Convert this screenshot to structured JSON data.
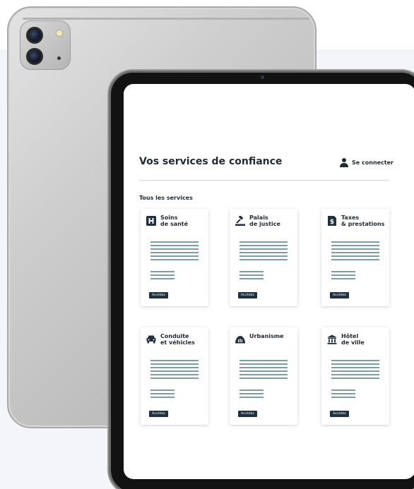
{
  "page": {
    "title": "Vos services de confiance",
    "login_label": "Se connecter",
    "section_label": "Tous les services"
  },
  "colors": {
    "accent_dark": "#1f3140",
    "text_dark": "#1f2a33",
    "placeholder_line": "#7a9ea3",
    "divider": "#cfd4d8"
  },
  "services": [
    {
      "title": "Soins\nde santé",
      "icon": "hospital-icon",
      "button_label": "Accédez"
    },
    {
      "title": "Palais\nde justice",
      "icon": "gavel-icon",
      "button_label": "Accédez"
    },
    {
      "title": "Taxes\n& prestations",
      "icon": "tax-document-icon",
      "button_label": "Accédez"
    },
    {
      "title": "Conduite\net véhicles",
      "icon": "car-icon",
      "button_label": "Accédez"
    },
    {
      "title": "Urbanisme",
      "icon": "urban-dome-icon",
      "button_label": "Accédez"
    },
    {
      "title": "Hôtel\nde ville",
      "icon": "city-hall-icon",
      "button_label": "Accédez"
    }
  ]
}
